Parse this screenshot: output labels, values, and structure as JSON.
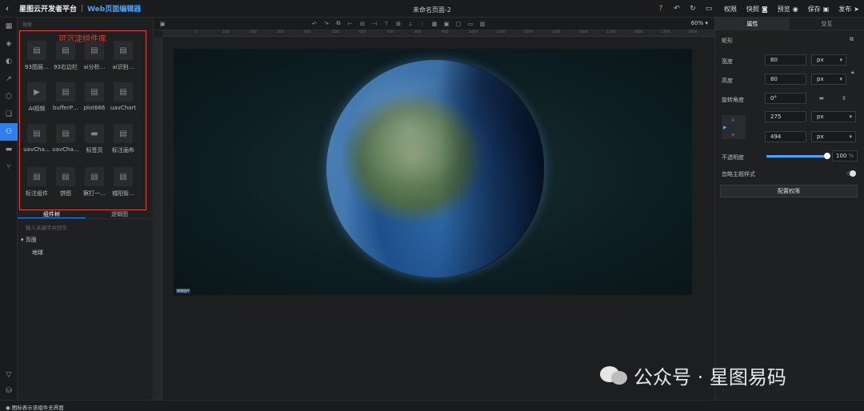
{
  "header": {
    "app_title": "星图云开发者平台",
    "separator": "|",
    "editor_title": "Web页面编辑器",
    "page_name": "未命名页面-2",
    "actions": [
      "权限",
      "快照",
      "预览",
      "保存",
      "发布"
    ]
  },
  "component_library": {
    "search_placeholder": "搜索",
    "annotation": "可沉淀组件库",
    "items": [
      "93图层…",
      "93右边栏",
      "ai分析…",
      "ai识别…",
      "AI视频",
      "bufferP…",
      "plot666",
      "uavChart",
      "uavCha…",
      "uavCha…",
      "标签页",
      "标注画布",
      "标注组件",
      "饼图",
      "察打一…",
      "城阳街…"
    ]
  },
  "tree": {
    "tabs": [
      "组件树",
      "逻辑图"
    ],
    "search_placeholder": "输入关键字并回车",
    "page_label": "页面",
    "child_label": "地球"
  },
  "canvas": {
    "zoom": "60%",
    "ruler_ticks": [
      "0",
      "100",
      "200",
      "300",
      "400",
      "500",
      "600",
      "700",
      "800",
      "900",
      "1000",
      "1100",
      "1200",
      "1300",
      "1400",
      "1500",
      "1600",
      "1700",
      "1800"
    ],
    "stage_tag": "地球组件"
  },
  "properties": {
    "tabs": [
      "属性",
      "交互"
    ],
    "section": "矩形",
    "width_label": "宽度",
    "width_value": "80",
    "height_label": "高度",
    "height_value": "80",
    "unit": "px",
    "rotation_label": "旋转角度",
    "rotation_value": "0°",
    "x_value": "275",
    "y_value": "494",
    "opacity_label": "不透明度",
    "opacity_value": "100",
    "opacity_unit": "%",
    "opacity_fraction": 1.0,
    "ignore_theme_label": "忽略主题样式",
    "permission_button": "配置权限"
  },
  "status_bar": {
    "text": "图标表示该组件无界面"
  },
  "watermark": {
    "text": "公众号 · 星图易码"
  },
  "colors": {
    "accent": "#2f80ed",
    "annotation": "#e2483d",
    "link": "#4aa3ff"
  }
}
